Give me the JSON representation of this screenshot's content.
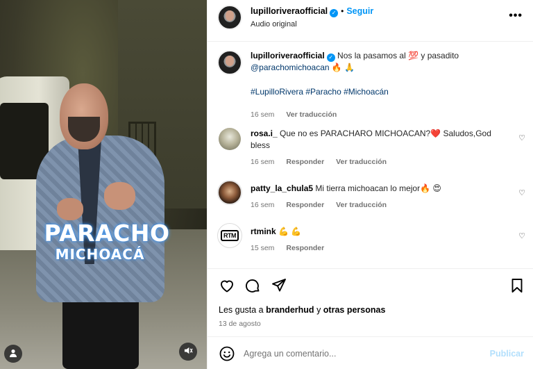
{
  "video": {
    "caption_line1": "PARACHO",
    "caption_line2": "MICHOACÁ",
    "user_icon": "person-icon",
    "mute_icon": "muted-speaker-icon"
  },
  "header": {
    "username": "lupilloriveraofficial",
    "verified": true,
    "separator": "•",
    "follow_label": "Seguir",
    "subtitle": "Audio original",
    "more_label": "•••"
  },
  "post": {
    "username": "lupilloriveraofficial",
    "text": "Nos la pasamos al 💯 y pasadito",
    "mention": "@parachomichoacan",
    "emojis": "🔥 🙏",
    "hashtags": "#LupilloRivera #Paracho #Michoacán",
    "time": "16 sem",
    "translate_label": "Ver traducción"
  },
  "comments": [
    {
      "username": "rosa.i_",
      "text": "Que no es PARACHARO MICHOACAN?❤️  Saludos,God bless",
      "time": "16 sem",
      "reply_label": "Responder",
      "translate_label": "Ver traducción"
    },
    {
      "username": "patty_la_chula5",
      "text": "Mi tierra michoacan lo mejor🔥 😍",
      "time": "16 sem",
      "reply_label": "Responder",
      "translate_label": "Ver traducción"
    },
    {
      "username": "rtmink",
      "text": "💪 💪",
      "time": "15 sem",
      "reply_label": "Responder",
      "avatar_text": "RTM"
    }
  ],
  "actions": {
    "likes_prefix": "Les gusta a",
    "likes_user": "branderhud",
    "likes_conj": "y",
    "likes_others": "otras personas",
    "date": "13 de agosto"
  },
  "compose": {
    "placeholder": "Agrega un comentario...",
    "publish_label": "Publicar"
  },
  "colors": {
    "accent": "#0095f6",
    "link": "#00376b",
    "muted": "#737373",
    "publish_disabled": "#b2dffc"
  }
}
